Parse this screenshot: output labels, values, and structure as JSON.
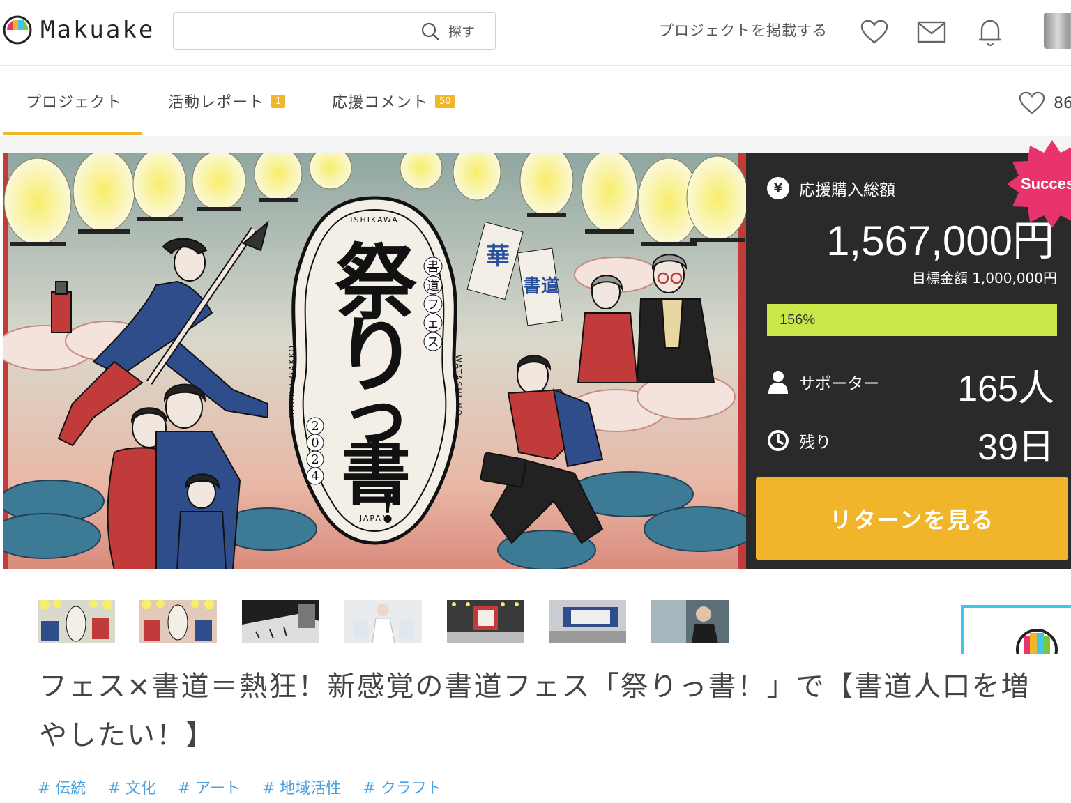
{
  "header": {
    "logo_text": "Makuake",
    "search_placeholder": "",
    "search_button_label": "探す",
    "post_project_link": "プロジェクトを掲載する"
  },
  "tabs": [
    {
      "label": "プロジェクト",
      "badge": ""
    },
    {
      "label": "活動レポート",
      "badge": "1"
    },
    {
      "label": "応援コメント",
      "badge": "50"
    }
  ],
  "like_count": "86",
  "hero_art": {
    "main_title": "祭りっ書！",
    "sub_title": "書道フェス",
    "year": "2024",
    "arc_top": "ISHIKAWA",
    "arc_bottom": "JAPAN",
    "side_left": "SHODO GAKKO",
    "side_right": "WATASHI NO",
    "flag_1": "華",
    "flag_2": "書道"
  },
  "stats": {
    "purchase_label": "応援購入総額",
    "amount": "1,567,000円",
    "goal": "目標金額 1,000,000円",
    "progress_text": "156%",
    "progress_fraction": 1.0,
    "supporters_label": "サポーター",
    "supporters_value": "165人",
    "remaining_label": "残り",
    "remaining_value": "39日",
    "cta_label": "リターンを見る",
    "success_badge": "Succes"
  },
  "title": "フェス×書道＝熱狂！新感覚の書道フェス「祭りっ書！」で【書道人口を増やしたい！】",
  "tags": [
    "# 伝統",
    "# 文化",
    "# アート",
    "# 地域活性",
    "# クラフト"
  ],
  "colors": {
    "accent": "#f0b52b",
    "panel_bg": "#2a2a2a",
    "progress": "#c8e84a",
    "tag": "#4aa3e0",
    "badge": "#e8336d"
  }
}
